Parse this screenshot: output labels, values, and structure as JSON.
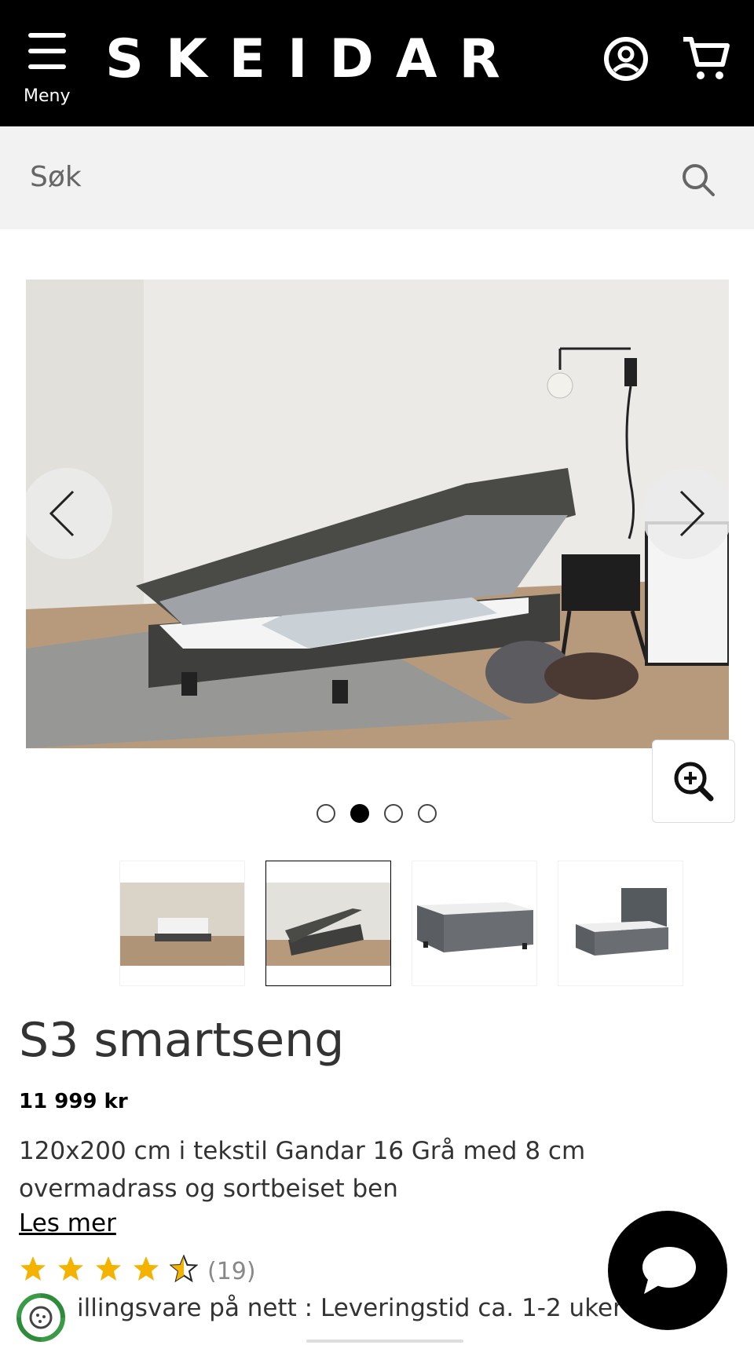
{
  "header": {
    "menu_label": "Meny",
    "logo": "SKEIDAR",
    "account_icon": "user-circle-icon",
    "cart_icon": "shopping-cart-icon"
  },
  "search": {
    "placeholder": "Søk",
    "icon": "search-icon"
  },
  "gallery": {
    "slide_count": 4,
    "active_index": 1,
    "prev_icon": "chevron-left-icon",
    "next_icon": "chevron-right-icon",
    "zoom_icon": "zoom-in-icon"
  },
  "product": {
    "title": "S3 smartseng",
    "price": "11 999 kr",
    "description": "120x200 cm i tekstil Gandar 16 Grå med 8 cm overmadrass og sortbeiset ben",
    "read_more": "Les mer",
    "rating": 4.5,
    "rating_max": 5,
    "review_count": "(19)",
    "delivery": "illingsvare på nett : Leveringstid ca. 1-2 uker"
  },
  "colors": {
    "header_bg": "#000000",
    "search_bg": "#f2f2f2",
    "star": "#f5b301",
    "eco_green": "#2e8b3a"
  },
  "chat": {
    "icon": "chat-bubble-icon"
  }
}
